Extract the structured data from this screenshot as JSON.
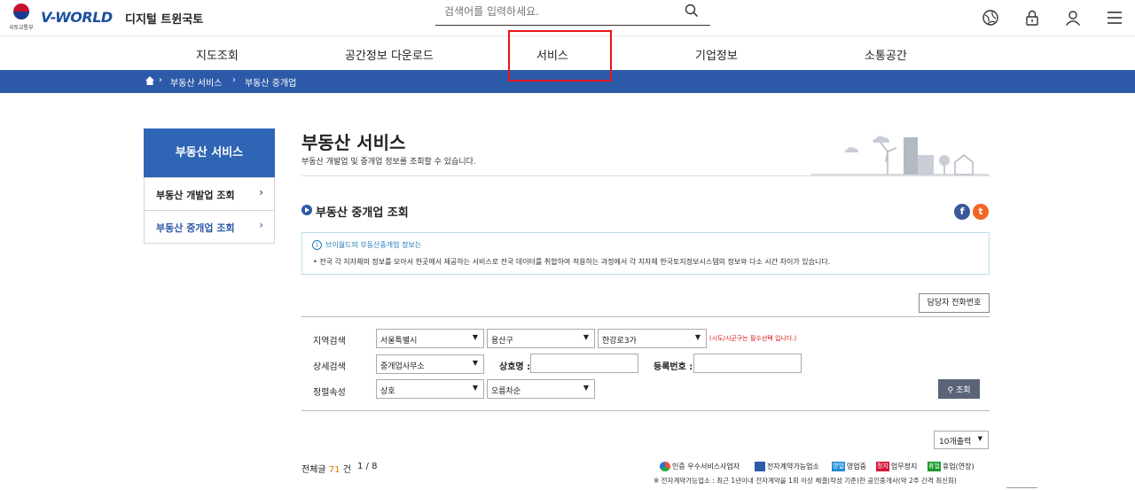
{
  "header": {
    "ministry": "국토교통부",
    "logo": "V-WORLD",
    "logo_sub": "디지털 트윈국토",
    "search_placeholder": "검색어를 입력하세요."
  },
  "gnb": [
    "지도조회",
    "공간정보 다운로드",
    "서비스",
    "기업정보",
    "소통공간"
  ],
  "breadcrumb": [
    "부동산 서비스",
    "부동산 중개업"
  ],
  "lnb": {
    "title": "부동산 서비스",
    "items": [
      "부동산 개발업 조회",
      "부동산 중개업 조회"
    ]
  },
  "page": {
    "title": "부동산 서비스",
    "subtitle": "부동산 개발업 및 중개업 정보를 조회할 수 있습니다.",
    "section_title": "부동산 중개업 조회"
  },
  "info": {
    "title": "브이월드의 부동산중개업 정보는",
    "text": "• 전국 각 지자체의 정보를 모아서 한곳에서 제공하는 서비스로 전국 데이터를 취합하여 적용하는 과정에서 각 지자체 한국토지정보시스템의 정보와 다소 시간 차이가 있습니다."
  },
  "form": {
    "phone_button": "담당자 전화번호",
    "region_label": "지역검색",
    "sido": "서울특별시",
    "sigungu": "용산구",
    "dong": "한강로3가",
    "required_note": "(시도/시군구는 필수선택 입니다.)",
    "detail_label": "상세검색",
    "detail_type": "중개업사무소",
    "name_label": "상호명 :",
    "reg_label": "등록번호 :",
    "sort_label": "정렬속성",
    "sort_field": "상호",
    "sort_order": "오름차순",
    "search_button": "조회"
  },
  "results": {
    "per_page": "10개출력",
    "total_label": "전체글",
    "total": "71",
    "total_unit": "건",
    "page": "1 / 8",
    "legend": [
      {
        "icon": "",
        "label": "인증 우수서비스사업자",
        "color": "#ffffff"
      },
      {
        "icon": "",
        "label": "전자계약가능업소",
        "color": "#2d5aa8"
      },
      {
        "icon": "영업",
        "label": "영업중",
        "color": "#1f8fd8"
      },
      {
        "icon": "정지",
        "label": "업무정지",
        "color": "#d6143c"
      },
      {
        "icon": "휴업",
        "label": "휴업(연장)",
        "color": "#1a9a2c"
      }
    ],
    "note": "※ 전자계약가능업소 : 최근 1년이내 전자계약을 1회 이상 체결(작성 기준)한 공인중개사(약 2주 간격 최신화)"
  }
}
